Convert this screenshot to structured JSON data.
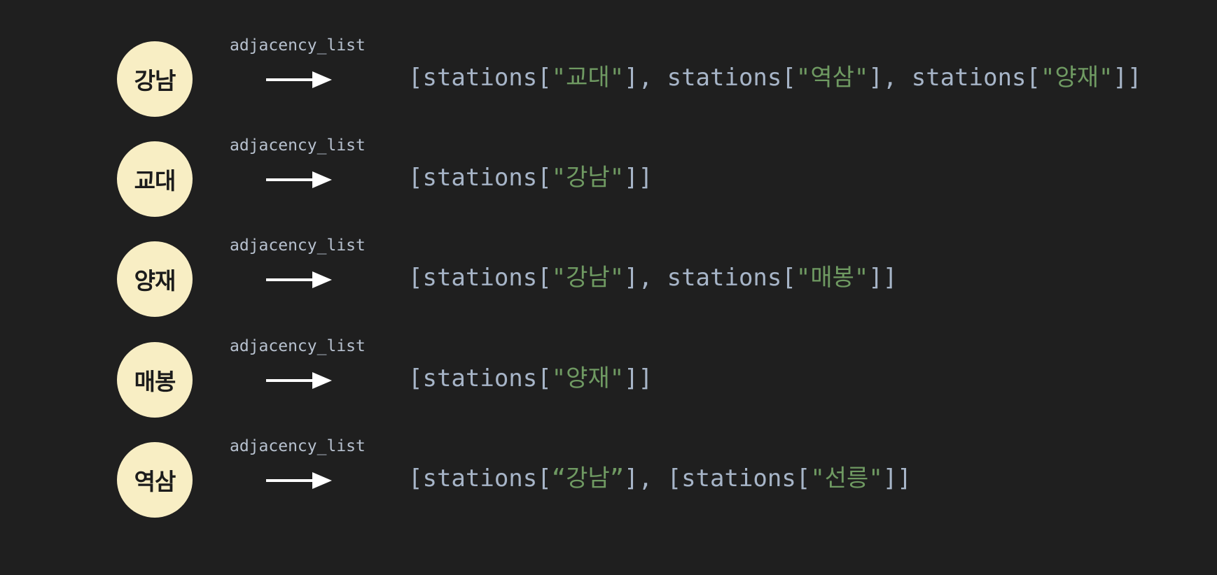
{
  "edge_label": "adjacency_list",
  "rows": [
    {
      "station": "강남",
      "parts": [
        {
          "t": "[stations[",
          "s": false
        },
        {
          "t": "\"교대\"",
          "s": true
        },
        {
          "t": "], stations[",
          "s": false
        },
        {
          "t": "\"역삼\"",
          "s": true
        },
        {
          "t": "], stations[",
          "s": false
        },
        {
          "t": "\"양재\"",
          "s": true
        },
        {
          "t": "]]",
          "s": false
        }
      ]
    },
    {
      "station": "교대",
      "parts": [
        {
          "t": "[stations[",
          "s": false
        },
        {
          "t": "\"강남\"",
          "s": true
        },
        {
          "t": "]]",
          "s": false
        }
      ]
    },
    {
      "station": "양재",
      "parts": [
        {
          "t": "[stations[",
          "s": false
        },
        {
          "t": "\"강남\"",
          "s": true
        },
        {
          "t": "], stations[",
          "s": false
        },
        {
          "t": "\"매봉\"",
          "s": true
        },
        {
          "t": "]]",
          "s": false
        }
      ]
    },
    {
      "station": "매봉",
      "parts": [
        {
          "t": "[stations[",
          "s": false
        },
        {
          "t": "\"양재\"",
          "s": true
        },
        {
          "t": "]]",
          "s": false
        }
      ]
    },
    {
      "station": "역삼",
      "parts": [
        {
          "t": "[stations[",
          "s": false
        },
        {
          "t": "“강남”",
          "s": true
        },
        {
          "t": "], [stations[",
          "s": false
        },
        {
          "t": "\"선릉\"",
          "s": true
        },
        {
          "t": "]]",
          "s": false
        }
      ]
    }
  ],
  "colors": {
    "background": "#1f1f1f",
    "node_fill": "#f8eec4",
    "node_text": "#1c1c1c",
    "label_text": "#b7c1cf",
    "code_text": "#a7b5c8",
    "string_text": "#6f9a62",
    "arrow": "#ffffff"
  }
}
